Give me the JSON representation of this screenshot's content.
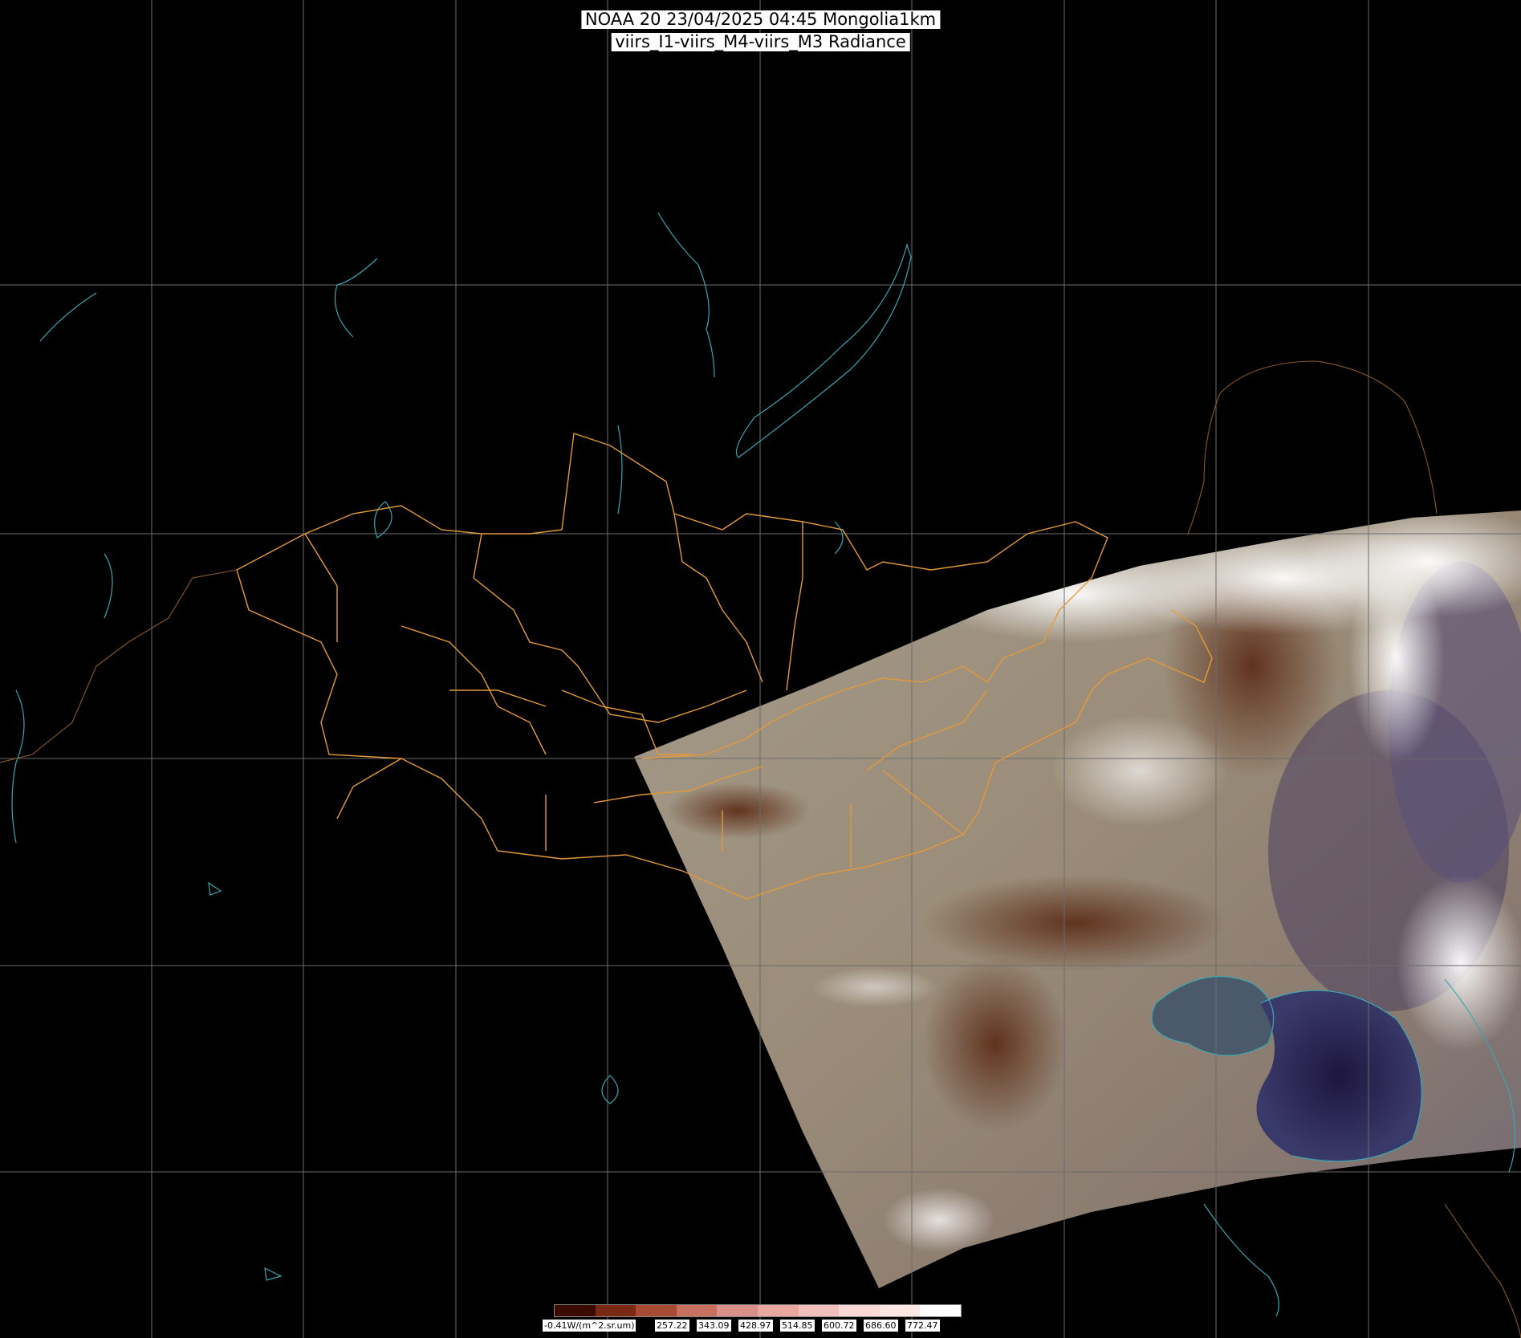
{
  "title": {
    "line1": "NOAA 20 23/04/2025 04:45 Mongolia1km",
    "line2": "viirs_I1-viirs_M4-viirs_M3 Radiance"
  },
  "colors": {
    "background": "#000000",
    "graticule": "#6b6b6b",
    "coastline": "#3aa6b0",
    "border": "#e39a3a",
    "international_border": "#8a5a2a"
  },
  "legend": {
    "unit_label": "-0.41W/(m^2.sr.um)",
    "ticks": [
      "257.22",
      "343.09",
      "428.97",
      "514.85",
      "600.72",
      "686.60",
      "772.47"
    ],
    "swatch_colors": [
      "#3b0a00",
      "#7a2a14",
      "#a84a34",
      "#c87060",
      "#d89088",
      "#e8a8a0",
      "#f2c0bc",
      "#fad8d6",
      "#fde8e6",
      "#ffffff"
    ]
  }
}
